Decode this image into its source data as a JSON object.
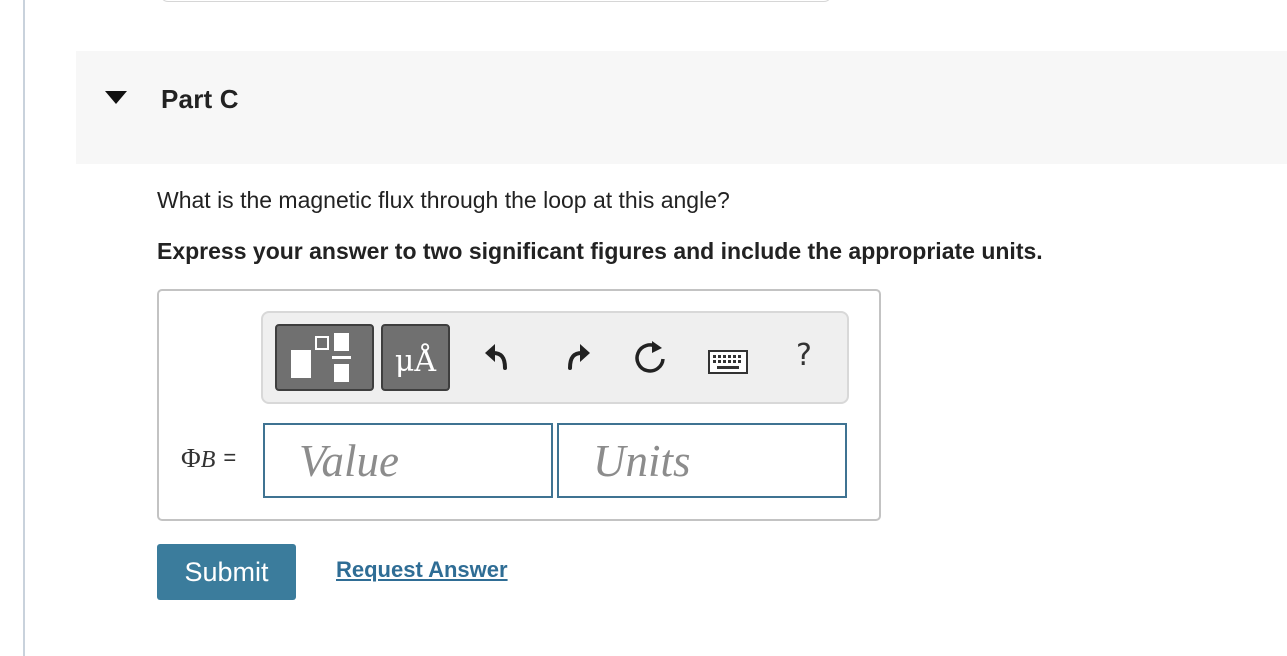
{
  "part": {
    "title": "Part C",
    "expanded": true
  },
  "question": "What is the magnetic flux through the loop at this angle?",
  "instruction": "Express your answer to two significant figures and include the appropriate units.",
  "toolbar": {
    "buttons": [
      {
        "name": "templates-button",
        "icon": "fraction-template-icon"
      },
      {
        "name": "units-button",
        "glyph": "μÅ"
      },
      {
        "name": "undo-button",
        "icon": "undo-arrow-icon"
      },
      {
        "name": "redo-button",
        "icon": "redo-arrow-icon"
      },
      {
        "name": "reset-button",
        "icon": "reset-circular-arrow-icon"
      },
      {
        "name": "keyboard-button",
        "icon": "keyboard-icon"
      },
      {
        "name": "help-button",
        "glyph": "?"
      }
    ]
  },
  "answer": {
    "symbol": "Φ",
    "subscript": "B",
    "equals": "=",
    "value_placeholder": "Value",
    "units_placeholder": "Units",
    "value": "",
    "units": ""
  },
  "actions": {
    "submit_label": "Submit",
    "request_answer_label": "Request Answer"
  },
  "colors": {
    "accent": "#3b7c9c",
    "link": "#2f6d95",
    "field_border": "#3f7392",
    "header_bg": "#f7f7f7"
  }
}
